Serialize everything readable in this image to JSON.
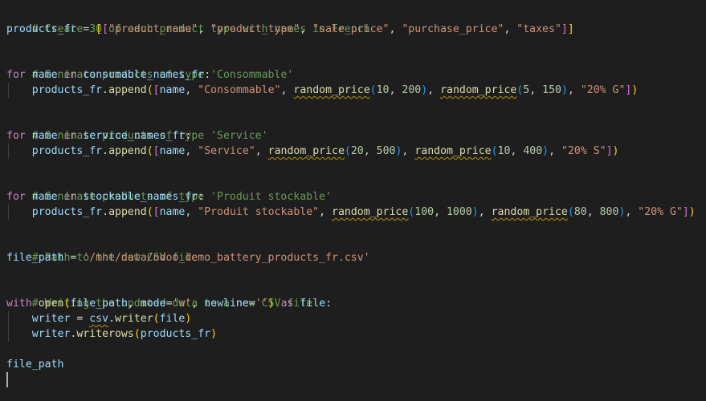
{
  "editor": {
    "language": "python",
    "lines": {
      "l1": "# Create 30 of each product type with names in French",
      "l2": {
        "var": "products_fr",
        "eq": " = ",
        "open": "[[",
        "s1": "\"product_name\"",
        "s2": "\"product_type\"",
        "s3": "\"sale_price\"",
        "s4": "\"purchase_price\"",
        "s5": "\"taxes\"",
        "close": "]]",
        "sep": ", "
      },
      "l4": "# Generate products of type 'Consommable'",
      "l5": {
        "kw_for": "for",
        "name": "name",
        "kw_in": "in",
        "iter": "consumable_names_fr",
        "colon": ":"
      },
      "l6": {
        "obj": "products_fr",
        "method": "append",
        "name": "name",
        "type": "\"Consommable\"",
        "fn": "random_price",
        "a1": "10",
        "a2": "200",
        "b1": "5",
        "b2": "150",
        "tax": "\"20% G\""
      },
      "l8": "# Generate products of type 'Service'",
      "l9": {
        "iter": "service_names_fr"
      },
      "l10": {
        "type": "\"Service\"",
        "a1": "20",
        "a2": "500",
        "b1": "10",
        "b2": "400",
        "tax": "\"20% S\""
      },
      "l12": "# Generate products of type 'Produit stockable'",
      "l13": {
        "iter": "stockable_names_fr"
      },
      "l14": {
        "type": "\"Produit stockable\"",
        "a1": "100",
        "a2": "1000",
        "b1": "80",
        "b2": "800",
        "tax": "\"20% G\""
      },
      "l16": "# Path to the new CSV file",
      "l17": {
        "var": "file_path",
        "eq": " = ",
        "str": "'/mnt/data/odoo_demo_battery_products_fr.csv'"
      },
      "l19": "# Writing the updated data to a new CSV file",
      "l20": {
        "kw_with": "with",
        "fn_open": "open",
        "arg1": "file_path",
        "kw_mode": "mode",
        "mode_val": "'w'",
        "kw_newline": "newline",
        "newline_val": "''",
        "kw_as": "as",
        "alias": "file"
      },
      "l21": {
        "var": "writer",
        "eq": " = ",
        "mod": "csv",
        "fn": "writer",
        "arg": "file"
      },
      "l22": {
        "obj": "writer",
        "fn": "writerows",
        "arg": "products_fr"
      },
      "l24": "file_path"
    }
  }
}
